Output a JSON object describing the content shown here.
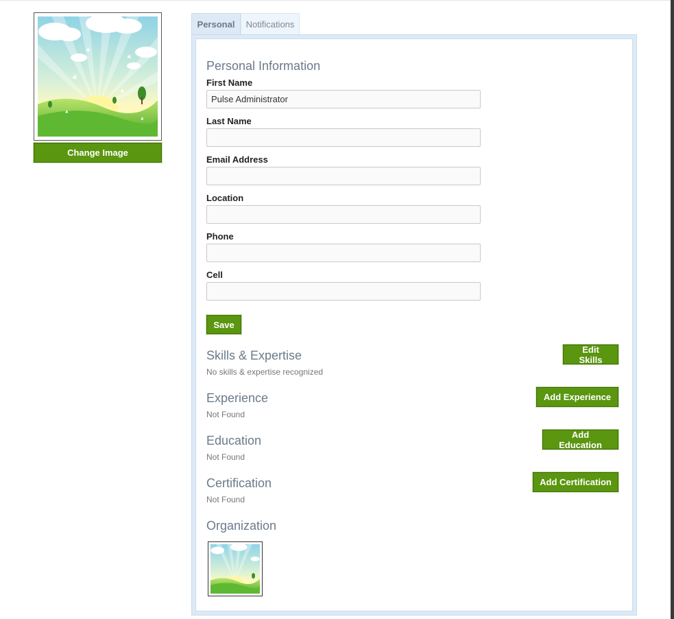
{
  "profile": {
    "change_image_label": "Change Image",
    "avatar_icon": "landscape-image"
  },
  "tabs": [
    {
      "label": "Personal",
      "active": true
    },
    {
      "label": "Notifications",
      "active": false
    }
  ],
  "personal": {
    "heading": "Personal Information",
    "fields": {
      "first_name": {
        "label": "First Name",
        "value": "Pulse Administrator"
      },
      "last_name": {
        "label": "Last Name",
        "value": ""
      },
      "email": {
        "label": "Email Address",
        "value": ""
      },
      "location": {
        "label": "Location",
        "value": ""
      },
      "phone": {
        "label": "Phone",
        "value": ""
      },
      "cell": {
        "label": "Cell",
        "value": ""
      }
    },
    "save_label": "Save"
  },
  "sections": {
    "skills": {
      "heading": "Skills & Expertise",
      "text": "No skills & expertise recognized",
      "button": "Edit Skills"
    },
    "experience": {
      "heading": "Experience",
      "text": "Not Found",
      "button": "Add Experience"
    },
    "education": {
      "heading": "Education",
      "text": "Not Found",
      "button": "Add Education"
    },
    "certification": {
      "heading": "Certification",
      "text": "Not Found",
      "button": "Add Certification"
    },
    "organization": {
      "heading": "Organization"
    }
  },
  "colors": {
    "button_green": "#5a960f",
    "heading_gray": "#6a7a8a",
    "tab_active_bg": "#dde9f5"
  }
}
